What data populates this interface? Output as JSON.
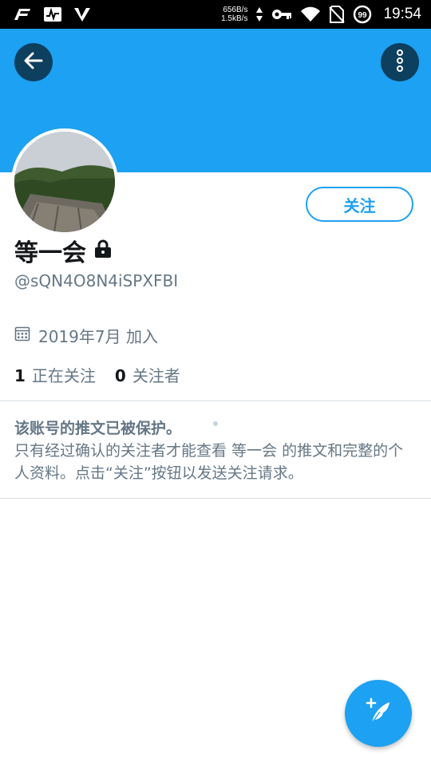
{
  "status_bar": {
    "net_up": "656B/s",
    "net_down": "1.5kB/s",
    "battery": "99",
    "time": "19:54",
    "icons": [
      "f-app-icon",
      "activity-icon",
      "v-app-icon",
      "key-icon",
      "wifi-icon",
      "no-sim-icon",
      "battery-icon"
    ]
  },
  "header": {
    "back_icon": "arrow-left-icon",
    "more_icon": "more-vertical-icon",
    "banner_color": "#1da1f2"
  },
  "profile": {
    "follow_label": "关注",
    "display_name": "等一会",
    "handle": "@sQN4O8N4iSPXFBI",
    "joined": "2019年7月 加入",
    "following_count": "1",
    "following_label": "正在关注",
    "followers_count": "0",
    "followers_label": "关注者",
    "lock_icon": "lock-icon",
    "calendar_icon": "calendar-icon"
  },
  "protected_notice": {
    "title": "该账号的推文已被保护。",
    "body": "只有经过确认的关注者才能查看 等一会 的推文和完整的个人资料。点击“关注”按钮以发送关注请求。"
  },
  "fab": {
    "icon": "compose-tweet-icon"
  },
  "colors": {
    "accent": "#1da1f2",
    "muted_text": "#657786",
    "dark_button": "#0d3f5f"
  }
}
